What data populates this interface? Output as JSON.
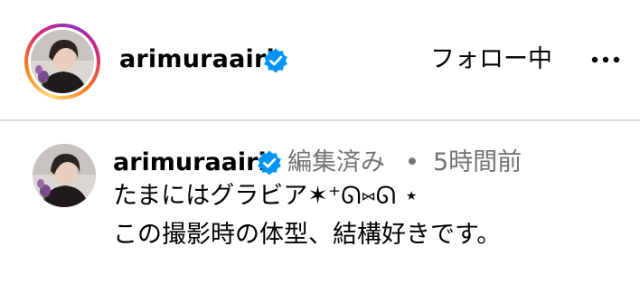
{
  "header": {
    "username": "arimuraairi",
    "verified_icon": "verified-badge-icon",
    "follow_button_label": "フォロー中",
    "more_icon": "more-horizontal-icon"
  },
  "comment": {
    "username": "arimuraairi",
    "verified_icon": "verified-badge-icon",
    "edited_label": "編集済み",
    "separator": "•",
    "timestamp": "5時間前",
    "caption_lines": [
      "たまにはグラビア✶⁺ᘏ⑅ᘏ ⋆",
      "この撮影時の体型、結構好きです。"
    ]
  },
  "colors": {
    "verified_blue": "#0095f6",
    "secondary_text": "#737373",
    "divider": "#dbdbdb",
    "story_ring_gradient": [
      "#feda75",
      "#fa7e1e",
      "#d62976",
      "#962fbf"
    ]
  }
}
